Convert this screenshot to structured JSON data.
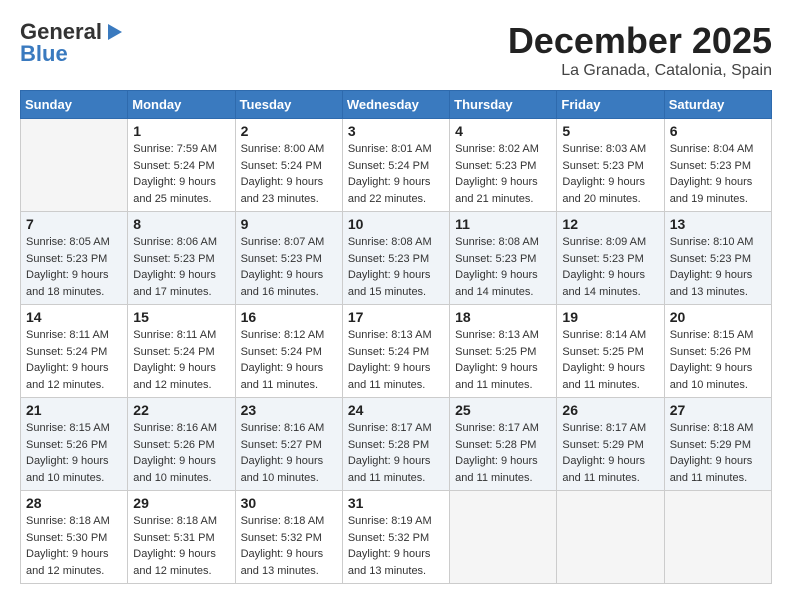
{
  "header": {
    "logo_line1": "General",
    "logo_line2": "Blue",
    "month_title": "December 2025",
    "location": "La Granada, Catalonia, Spain"
  },
  "days_of_week": [
    "Sunday",
    "Monday",
    "Tuesday",
    "Wednesday",
    "Thursday",
    "Friday",
    "Saturday"
  ],
  "weeks": [
    [
      {
        "day": "",
        "sunrise": "",
        "sunset": "",
        "daylight": ""
      },
      {
        "day": "1",
        "sunrise": "Sunrise: 7:59 AM",
        "sunset": "Sunset: 5:24 PM",
        "daylight": "Daylight: 9 hours and 25 minutes."
      },
      {
        "day": "2",
        "sunrise": "Sunrise: 8:00 AM",
        "sunset": "Sunset: 5:24 PM",
        "daylight": "Daylight: 9 hours and 23 minutes."
      },
      {
        "day": "3",
        "sunrise": "Sunrise: 8:01 AM",
        "sunset": "Sunset: 5:24 PM",
        "daylight": "Daylight: 9 hours and 22 minutes."
      },
      {
        "day": "4",
        "sunrise": "Sunrise: 8:02 AM",
        "sunset": "Sunset: 5:23 PM",
        "daylight": "Daylight: 9 hours and 21 minutes."
      },
      {
        "day": "5",
        "sunrise": "Sunrise: 8:03 AM",
        "sunset": "Sunset: 5:23 PM",
        "daylight": "Daylight: 9 hours and 20 minutes."
      },
      {
        "day": "6",
        "sunrise": "Sunrise: 8:04 AM",
        "sunset": "Sunset: 5:23 PM",
        "daylight": "Daylight: 9 hours and 19 minutes."
      }
    ],
    [
      {
        "day": "7",
        "sunrise": "Sunrise: 8:05 AM",
        "sunset": "Sunset: 5:23 PM",
        "daylight": "Daylight: 9 hours and 18 minutes."
      },
      {
        "day": "8",
        "sunrise": "Sunrise: 8:06 AM",
        "sunset": "Sunset: 5:23 PM",
        "daylight": "Daylight: 9 hours and 17 minutes."
      },
      {
        "day": "9",
        "sunrise": "Sunrise: 8:07 AM",
        "sunset": "Sunset: 5:23 PM",
        "daylight": "Daylight: 9 hours and 16 minutes."
      },
      {
        "day": "10",
        "sunrise": "Sunrise: 8:08 AM",
        "sunset": "Sunset: 5:23 PM",
        "daylight": "Daylight: 9 hours and 15 minutes."
      },
      {
        "day": "11",
        "sunrise": "Sunrise: 8:08 AM",
        "sunset": "Sunset: 5:23 PM",
        "daylight": "Daylight: 9 hours and 14 minutes."
      },
      {
        "day": "12",
        "sunrise": "Sunrise: 8:09 AM",
        "sunset": "Sunset: 5:23 PM",
        "daylight": "Daylight: 9 hours and 14 minutes."
      },
      {
        "day": "13",
        "sunrise": "Sunrise: 8:10 AM",
        "sunset": "Sunset: 5:23 PM",
        "daylight": "Daylight: 9 hours and 13 minutes."
      }
    ],
    [
      {
        "day": "14",
        "sunrise": "Sunrise: 8:11 AM",
        "sunset": "Sunset: 5:24 PM",
        "daylight": "Daylight: 9 hours and 12 minutes."
      },
      {
        "day": "15",
        "sunrise": "Sunrise: 8:11 AM",
        "sunset": "Sunset: 5:24 PM",
        "daylight": "Daylight: 9 hours and 12 minutes."
      },
      {
        "day": "16",
        "sunrise": "Sunrise: 8:12 AM",
        "sunset": "Sunset: 5:24 PM",
        "daylight": "Daylight: 9 hours and 11 minutes."
      },
      {
        "day": "17",
        "sunrise": "Sunrise: 8:13 AM",
        "sunset": "Sunset: 5:24 PM",
        "daylight": "Daylight: 9 hours and 11 minutes."
      },
      {
        "day": "18",
        "sunrise": "Sunrise: 8:13 AM",
        "sunset": "Sunset: 5:25 PM",
        "daylight": "Daylight: 9 hours and 11 minutes."
      },
      {
        "day": "19",
        "sunrise": "Sunrise: 8:14 AM",
        "sunset": "Sunset: 5:25 PM",
        "daylight": "Daylight: 9 hours and 11 minutes."
      },
      {
        "day": "20",
        "sunrise": "Sunrise: 8:15 AM",
        "sunset": "Sunset: 5:26 PM",
        "daylight": "Daylight: 9 hours and 10 minutes."
      }
    ],
    [
      {
        "day": "21",
        "sunrise": "Sunrise: 8:15 AM",
        "sunset": "Sunset: 5:26 PM",
        "daylight": "Daylight: 9 hours and 10 minutes."
      },
      {
        "day": "22",
        "sunrise": "Sunrise: 8:16 AM",
        "sunset": "Sunset: 5:26 PM",
        "daylight": "Daylight: 9 hours and 10 minutes."
      },
      {
        "day": "23",
        "sunrise": "Sunrise: 8:16 AM",
        "sunset": "Sunset: 5:27 PM",
        "daylight": "Daylight: 9 hours and 10 minutes."
      },
      {
        "day": "24",
        "sunrise": "Sunrise: 8:17 AM",
        "sunset": "Sunset: 5:28 PM",
        "daylight": "Daylight: 9 hours and 11 minutes."
      },
      {
        "day": "25",
        "sunrise": "Sunrise: 8:17 AM",
        "sunset": "Sunset: 5:28 PM",
        "daylight": "Daylight: 9 hours and 11 minutes."
      },
      {
        "day": "26",
        "sunrise": "Sunrise: 8:17 AM",
        "sunset": "Sunset: 5:29 PM",
        "daylight": "Daylight: 9 hours and 11 minutes."
      },
      {
        "day": "27",
        "sunrise": "Sunrise: 8:18 AM",
        "sunset": "Sunset: 5:29 PM",
        "daylight": "Daylight: 9 hours and 11 minutes."
      }
    ],
    [
      {
        "day": "28",
        "sunrise": "Sunrise: 8:18 AM",
        "sunset": "Sunset: 5:30 PM",
        "daylight": "Daylight: 9 hours and 12 minutes."
      },
      {
        "day": "29",
        "sunrise": "Sunrise: 8:18 AM",
        "sunset": "Sunset: 5:31 PM",
        "daylight": "Daylight: 9 hours and 12 minutes."
      },
      {
        "day": "30",
        "sunrise": "Sunrise: 8:18 AM",
        "sunset": "Sunset: 5:32 PM",
        "daylight": "Daylight: 9 hours and 13 minutes."
      },
      {
        "day": "31",
        "sunrise": "Sunrise: 8:19 AM",
        "sunset": "Sunset: 5:32 PM",
        "daylight": "Daylight: 9 hours and 13 minutes."
      },
      {
        "day": "",
        "sunrise": "",
        "sunset": "",
        "daylight": ""
      },
      {
        "day": "",
        "sunrise": "",
        "sunset": "",
        "daylight": ""
      },
      {
        "day": "",
        "sunrise": "",
        "sunset": "",
        "daylight": ""
      }
    ]
  ]
}
